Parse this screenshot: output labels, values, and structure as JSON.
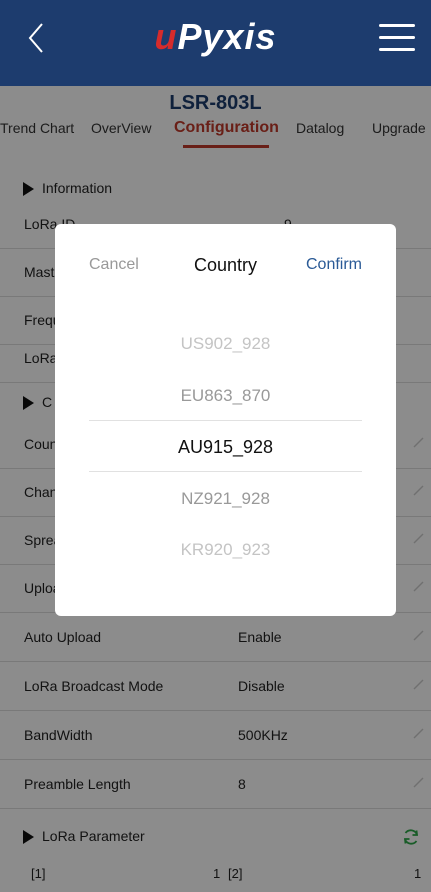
{
  "header": {
    "logo_prefix": "u",
    "logo_text": "Pyxis",
    "back_icon": "chevron-left-icon",
    "menu_icon": "hamburger-menu-icon",
    "bg_color": "#1d3c6e",
    "logo_accent": "#d62b2b"
  },
  "device": {
    "title": "LSR-803L"
  },
  "tabs": [
    {
      "label": "Trend Chart"
    },
    {
      "label": "OverView"
    },
    {
      "label": "Configuration"
    },
    {
      "label": "Datalog"
    },
    {
      "label": "Upgrade"
    }
  ],
  "info_section": {
    "title": "Information",
    "rows": [
      {
        "label": "LoRa ID",
        "value": "9"
      },
      {
        "label": "Mast",
        "value": ""
      },
      {
        "label": "Frequ",
        "value": ""
      },
      {
        "label": "LoRa",
        "value": ""
      }
    ]
  },
  "config_section": {
    "title": "C",
    "rows": [
      {
        "label": "Coun",
        "value": ""
      },
      {
        "label": "Chan",
        "value": ""
      },
      {
        "label": "Sprea",
        "value": ""
      },
      {
        "label": "Uploa",
        "value": ""
      },
      {
        "label": "Auto Upload",
        "value": "Enable"
      },
      {
        "label": "LoRa Broadcast Mode",
        "value": "Disable"
      },
      {
        "label": "BandWidth",
        "value": "500KHz"
      },
      {
        "label": "Preamble Length",
        "value": "8"
      }
    ]
  },
  "lora_param": {
    "title": "LoRa Parameter",
    "refresh_icon": "refresh-icon",
    "items": [
      {
        "key": "[1]",
        "value": "1"
      },
      {
        "key": "[2]",
        "value": "1"
      }
    ]
  },
  "dialog": {
    "cancel": "Cancel",
    "title": "Country",
    "confirm": "Confirm",
    "options": [
      "US902_928",
      "EU863_870",
      "AU915_928",
      "NZ921_928",
      "KR920_923"
    ],
    "selected": "AU915_928"
  },
  "colors": {
    "accent_tab": "#c0392b",
    "confirm": "#2a5a96",
    "refresh": "#2ea84a"
  }
}
